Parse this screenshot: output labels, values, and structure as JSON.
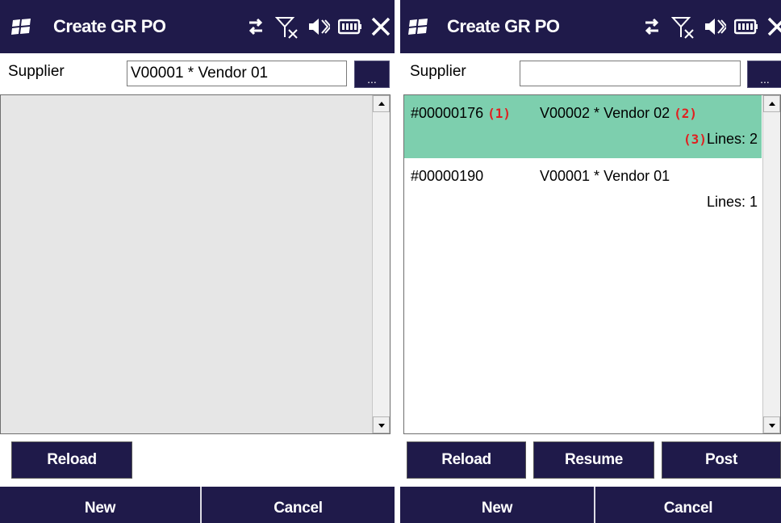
{
  "colors": {
    "titlebar_bg": "#1f1a4a",
    "button_bg": "#1f1a4a",
    "selected_row_bg": "#7dcfae",
    "list_bg_empty": "#e6e6e6",
    "marker_red": "#e02020"
  },
  "left_screen": {
    "title": "Create GR PO",
    "status_icons": [
      "sync-icon",
      "no-signal-icon",
      "speaker-muted-icon",
      "battery-icon",
      "close-icon"
    ],
    "supplier_label": "Supplier",
    "supplier_value": "V00001 * Vendor 01",
    "browse_label": "...",
    "buttons": {
      "reload": "Reload"
    },
    "bottom": {
      "new": "New",
      "cancel": "Cancel"
    }
  },
  "right_screen": {
    "title": "Create GR PO",
    "status_icons": [
      "sync-icon",
      "no-signal-icon",
      "speaker-muted-icon",
      "battery-icon",
      "close-icon"
    ],
    "supplier_label": "Supplier",
    "supplier_value": "",
    "browse_label": "...",
    "purchase_orders": [
      {
        "number": "#00000176",
        "vendor": "V00002 * Vendor 02",
        "lines": "Lines: 2",
        "selected": true,
        "markers": {
          "number": "(1)",
          "vendor": "(2)",
          "lines": "(3)"
        }
      },
      {
        "number": "#00000190",
        "vendor": "V00001 * Vendor 01",
        "lines": "Lines: 1",
        "selected": false
      }
    ],
    "buttons": {
      "reload": "Reload",
      "resume": "Resume",
      "post": "Post"
    },
    "bottom": {
      "new": "New",
      "cancel": "Cancel"
    }
  }
}
